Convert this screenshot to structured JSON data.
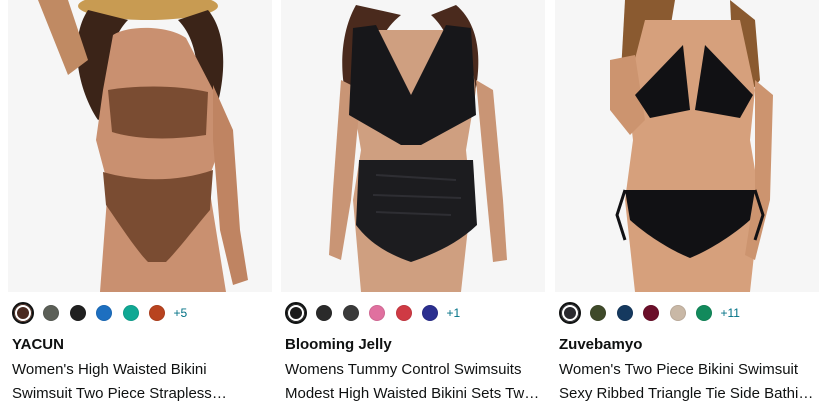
{
  "products": [
    {
      "brand": "YACUN",
      "title": "Women's High Waisted Bikini Swimsuit Two Piece Strapless Bandeau Bathing Suit",
      "image_icon": "brown-bikini-photo",
      "swatches": [
        "#4a2a20",
        "#5b5f57",
        "#202020",
        "#1d6fc0",
        "#10a894",
        "#b8431f"
      ],
      "selected_swatch": 0,
      "more_colors": "+5"
    },
    {
      "brand": "Blooming Jelly",
      "title": "Womens Tummy Control Swimsuits Modest High Waisted Bikini Sets Two Piece Bathing Suit",
      "image_icon": "black-bikini-photo",
      "swatches": [
        "#1c1c1c",
        "#2a2a2a",
        "#3a3a3a",
        "#e0709f",
        "#cf3a44",
        "#2b2f8f"
      ],
      "selected_swatch": 0,
      "more_colors": "+1"
    },
    {
      "brand": "Zuvebamyo",
      "title": "Women's Two Piece Bikini Swimsuit Sexy Ribbed Triangle Tie Side Bathing Suit",
      "image_icon": "black-triangle-bikini-photo",
      "swatches": [
        "#2a2a2f",
        "#3f4a2a",
        "#15395f",
        "#6b0f2a",
        "#c9b8a6",
        "#128a5c"
      ],
      "selected_swatch": 0,
      "more_colors": "+11"
    }
  ]
}
